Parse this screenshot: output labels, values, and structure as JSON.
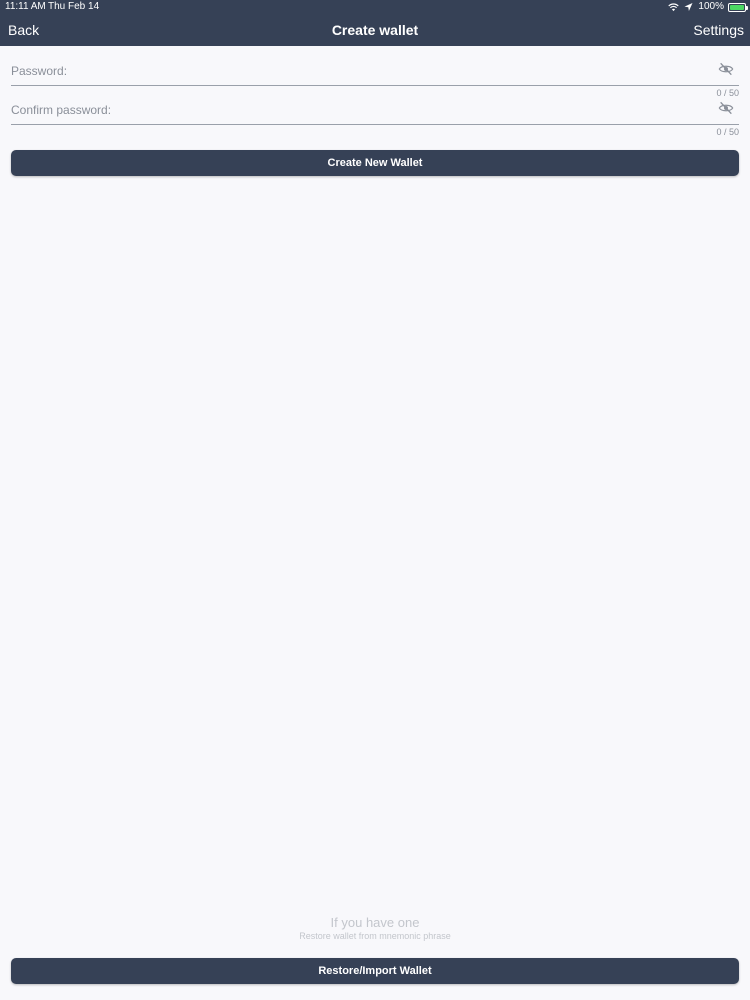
{
  "status_bar": {
    "time": "11:11 AM",
    "date": "Thu Feb 14",
    "battery": "100%"
  },
  "nav": {
    "back_label": "Back",
    "title": "Create wallet",
    "settings_label": "Settings"
  },
  "form": {
    "password": {
      "label": "Password:",
      "value": "",
      "counter": "0 / 50"
    },
    "confirm_password": {
      "label": "Confirm password:",
      "value": "",
      "counter": "0 / 50"
    },
    "create_button_label": "Create New Wallet"
  },
  "restore": {
    "hint_title": "If you have one",
    "hint_subtitle": "Restore wallet from mnemonic phrase",
    "button_label": "Restore/Import Wallet"
  },
  "colors": {
    "header_bg": "#364156",
    "button_bg": "#364156",
    "page_bg": "#f8f8fb",
    "battery_fill": "#4cd964"
  },
  "icons": [
    "wifi-icon",
    "location-icon",
    "battery-icon",
    "eye-off-icon"
  ]
}
